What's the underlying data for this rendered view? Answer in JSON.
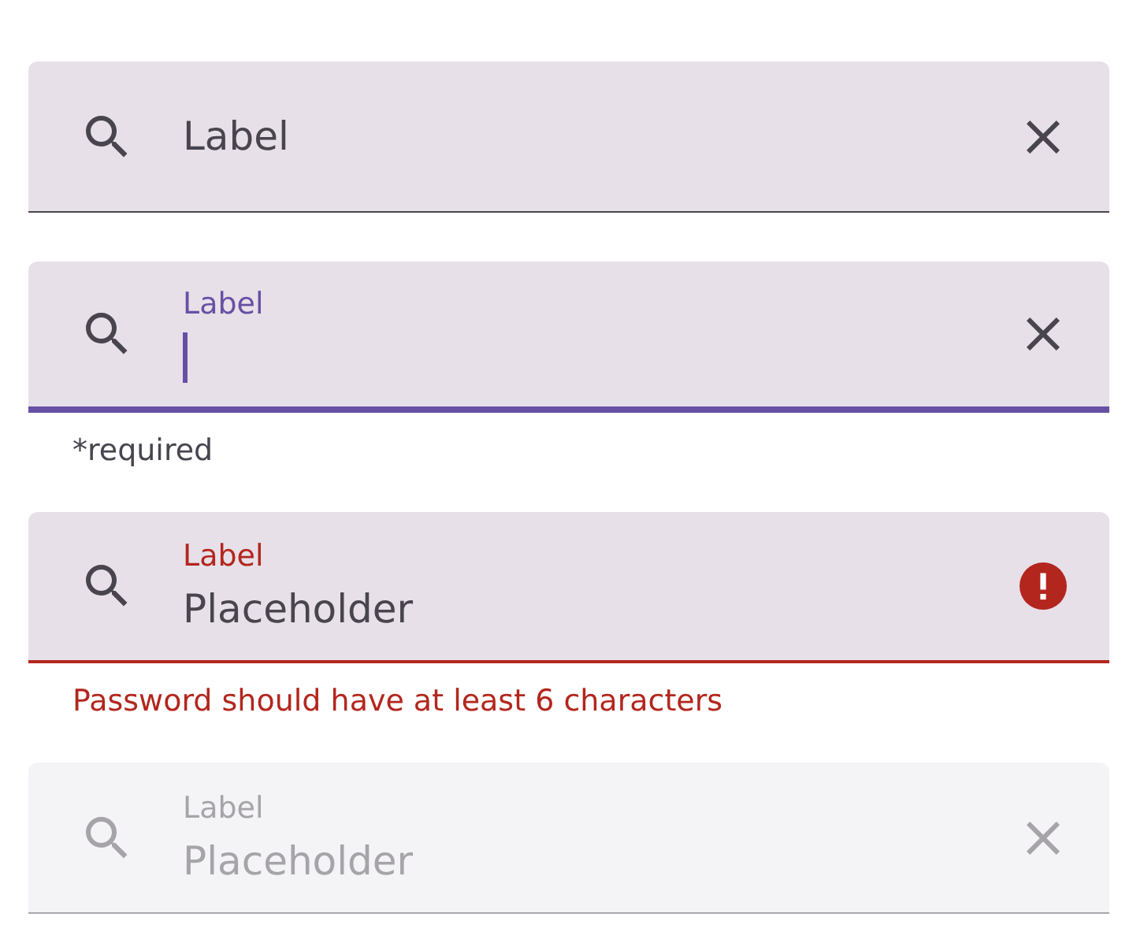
{
  "fields": [
    {
      "focused": false,
      "error": false,
      "disabled": false,
      "label": "Label"
    },
    {
      "focused": true,
      "error": false,
      "disabled": false,
      "label": "Label",
      "helper": "*required"
    },
    {
      "focused": false,
      "error": true,
      "disabled": false,
      "label": "Label",
      "value": "Placeholder",
      "helper": "Password should have at least 6 characters"
    },
    {
      "focused": false,
      "error": false,
      "disabled": true,
      "label": "Label",
      "value": "Placeholder"
    }
  ]
}
